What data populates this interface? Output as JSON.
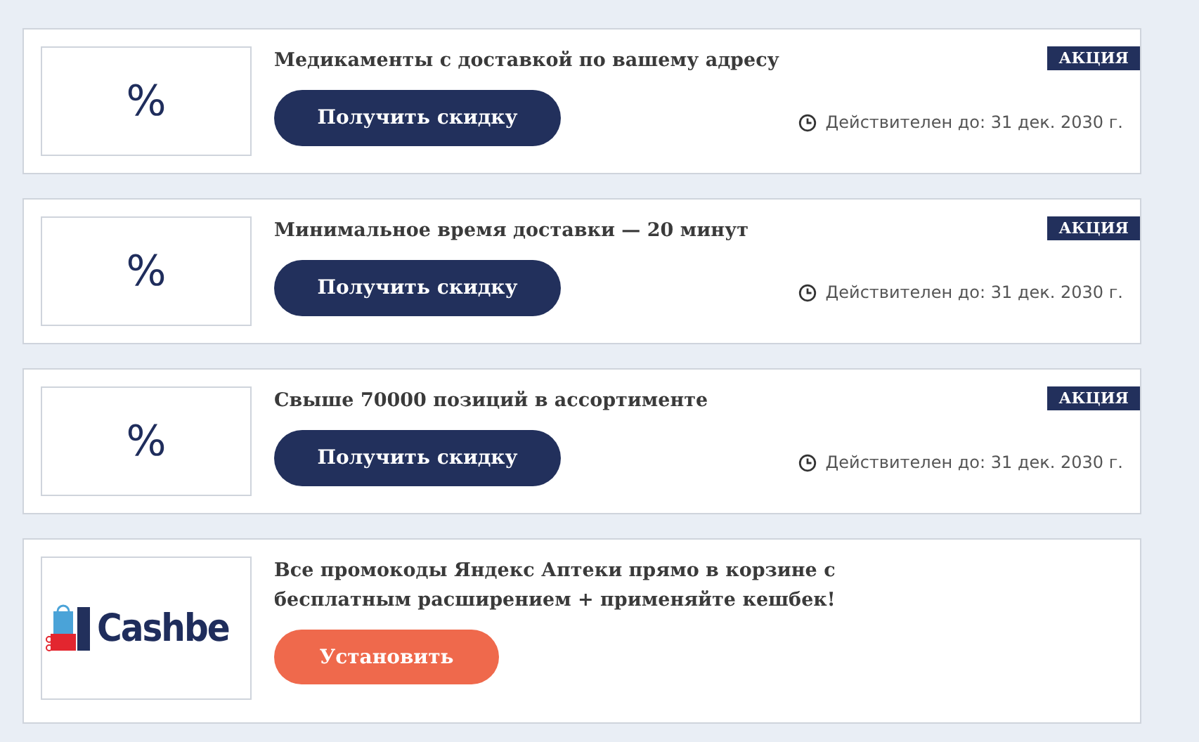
{
  "offers": [
    {
      "kind": "promo",
      "logo_text": "%",
      "title": "Медикаменты с доставкой по вашему адресу",
      "badge": "АКЦИЯ",
      "button": "Получить скидку",
      "valid": "Действителен до: 31 дек. 2030 г."
    },
    {
      "kind": "promo",
      "logo_text": "%",
      "title": "Минимальное время доставки — 20 минут",
      "badge": "АКЦИЯ",
      "button": "Получить скидку",
      "valid": "Действителен до: 31 дек. 2030 г."
    },
    {
      "kind": "promo",
      "logo_text": "%",
      "title": "Свыше 70000 позиций в ассортименте",
      "badge": "АКЦИЯ",
      "button": "Получить скидку",
      "valid": "Действителен до: 31 дек. 2030 г."
    },
    {
      "kind": "extension",
      "logo_text": "Cashbe",
      "title": "Все промокоды Яндекс Аптеки прямо в корзине с бесплатным расширением + применяйте кешбек!",
      "button": "Установить"
    }
  ]
}
